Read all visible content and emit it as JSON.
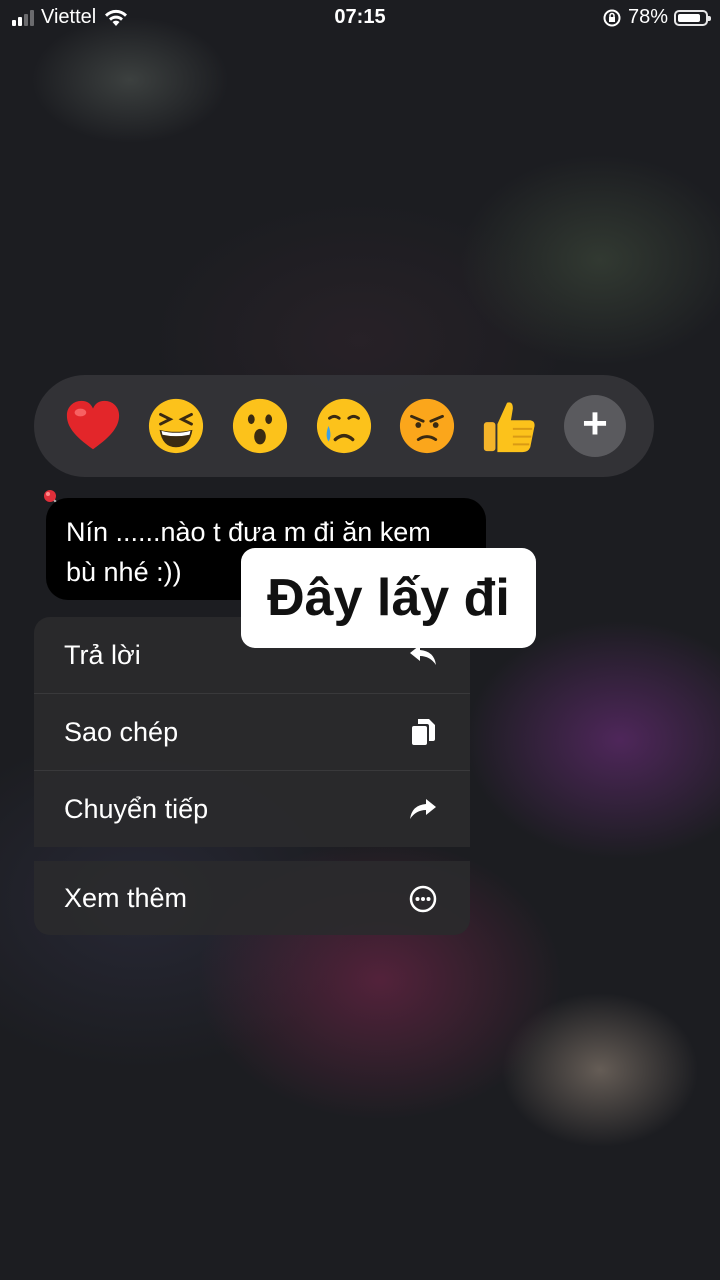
{
  "status_bar": {
    "carrier": "Viettel",
    "time": "07:15",
    "battery_percent": "78%",
    "battery_level": 0.78
  },
  "reactions": {
    "items": [
      "heart-emoji",
      "laughing-emoji",
      "surprised-emoji",
      "crying-emoji",
      "angry-emoji",
      "thumbs-up-emoji"
    ],
    "more": "+"
  },
  "message": {
    "text_line1": "Nín ......nào t đưa m đi ăn kem",
    "text_line2": "bù nhé :))"
  },
  "overlay": {
    "label": "Đây lấy đi"
  },
  "menu": {
    "items": [
      {
        "label": "Trả lời",
        "icon": "reply-icon"
      },
      {
        "label": "Sao chép",
        "icon": "copy-icon"
      },
      {
        "label": "Chuyển tiếp",
        "icon": "forward-icon"
      }
    ],
    "more": {
      "label": "Xem thêm",
      "icon": "more-icon"
    }
  },
  "colors": {
    "bubble": "#000000",
    "menu_bg": "#2a2a2c",
    "reaction_bar": "#343438"
  }
}
